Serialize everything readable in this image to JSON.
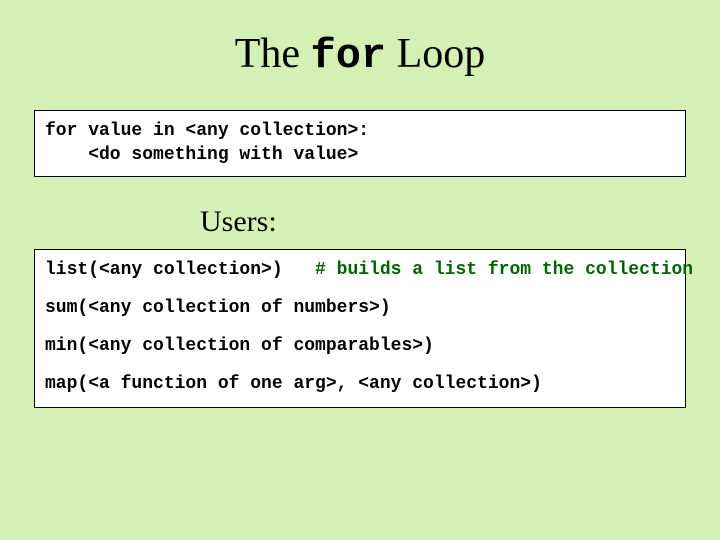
{
  "title": {
    "pre": "The ",
    "keyword": "for",
    "post": " Loop"
  },
  "syntax": {
    "line1": "for value in <any collection>:",
    "line2": "    <do something with value>"
  },
  "subheading": "Users:",
  "users": {
    "list": {
      "call": "list(<any collection>)",
      "pad": "   ",
      "comment": "# builds a list from the collection"
    },
    "sum": {
      "call": "sum(<any collection of numbers>)"
    },
    "min": {
      "call": "min(<any collection of comparables>)"
    },
    "map": {
      "call": "map(<a function of one arg>, <any collection>)"
    }
  }
}
